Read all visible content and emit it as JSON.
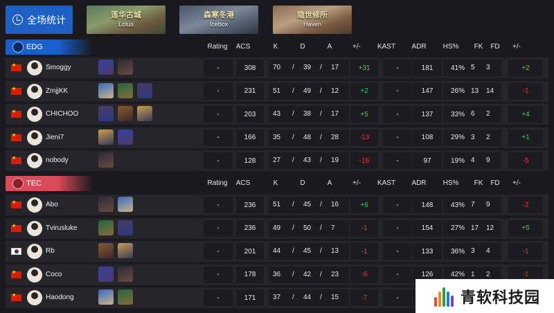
{
  "topbar": {
    "all_stats_label": "全场统计",
    "maps": [
      {
        "zh": "莲华古城",
        "en": "Lotus"
      },
      {
        "zh": "森寒冬港",
        "en": "Icebox"
      },
      {
        "zh": "隐世修所",
        "en": "Haven"
      }
    ]
  },
  "columns": [
    "Rating",
    "ACS",
    "K",
    "D",
    "A",
    "+/-",
    "KAST",
    "ADR",
    "HS%",
    "FK",
    "FD",
    "+/-"
  ],
  "teams": [
    {
      "name": "EDG",
      "players": [
        {
          "flag": "cn",
          "name": "Smoggy",
          "agents": [
            "agent-1",
            "agent-2"
          ],
          "rating": "-",
          "acs": "308",
          "k": "70",
          "d": "39",
          "a": "17",
          "kd_diff": "+31",
          "kast": "-",
          "adr": "181",
          "hs": "41%",
          "fk": "5",
          "fd": "3",
          "fkfd_diff": "+2"
        },
        {
          "flag": "cn",
          "name": "ZmjjKK",
          "agents": [
            "agent-1",
            "agent-2",
            "agent-3"
          ],
          "rating": "-",
          "acs": "231",
          "k": "51",
          "d": "49",
          "a": "12",
          "kd_diff": "+2",
          "kast": "-",
          "adr": "147",
          "hs": "26%",
          "fk": "13",
          "fd": "14",
          "fkfd_diff": "-1"
        },
        {
          "flag": "cn",
          "name": "CHICHOO",
          "agents": [
            "agent-1",
            "agent-2",
            "agent-3"
          ],
          "rating": "-",
          "acs": "203",
          "k": "43",
          "d": "38",
          "a": "17",
          "kd_diff": "+5",
          "kast": "-",
          "adr": "137",
          "hs": "33%",
          "fk": "6",
          "fd": "2",
          "fkfd_diff": "+4"
        },
        {
          "flag": "cn",
          "name": "Jieni7",
          "agents": [
            "agent-1",
            "agent-2"
          ],
          "rating": "-",
          "acs": "166",
          "k": "35",
          "d": "48",
          "a": "28",
          "kd_diff": "-13",
          "kast": "-",
          "adr": "108",
          "hs": "29%",
          "fk": "3",
          "fd": "2",
          "fkfd_diff": "+1"
        },
        {
          "flag": "cn",
          "name": "nobody",
          "agents": [
            "agent-1"
          ],
          "rating": "-",
          "acs": "128",
          "k": "27",
          "d": "43",
          "a": "19",
          "kd_diff": "-16",
          "kast": "-",
          "adr": "97",
          "hs": "19%",
          "fk": "4",
          "fd": "9",
          "fkfd_diff": "-5"
        }
      ]
    },
    {
      "name": "TEC",
      "players": [
        {
          "flag": "cn",
          "name": "Abo",
          "agents": [
            "agent-1",
            "agent-2"
          ],
          "rating": "-",
          "acs": "236",
          "k": "51",
          "d": "45",
          "a": "16",
          "kd_diff": "+6",
          "kast": "-",
          "adr": "148",
          "hs": "43%",
          "fk": "7",
          "fd": "9",
          "fkfd_diff": "-2"
        },
        {
          "flag": "cn",
          "name": "Tvirusluke",
          "agents": [
            "agent-1",
            "agent-2"
          ],
          "rating": "-",
          "acs": "236",
          "k": "49",
          "d": "50",
          "a": "7",
          "kd_diff": "-1",
          "kast": "-",
          "adr": "154",
          "hs": "27%",
          "fk": "17",
          "fd": "12",
          "fkfd_diff": "+5"
        },
        {
          "flag": "kr",
          "name": "Rb",
          "agents": [
            "agent-1",
            "agent-2"
          ],
          "rating": "-",
          "acs": "201",
          "k": "44",
          "d": "45",
          "a": "13",
          "kd_diff": "-1",
          "kast": "-",
          "adr": "133",
          "hs": "36%",
          "fk": "3",
          "fd": "4",
          "fkfd_diff": "-1"
        },
        {
          "flag": "cn",
          "name": "Coco",
          "agents": [
            "agent-1",
            "agent-2"
          ],
          "rating": "-",
          "acs": "178",
          "k": "36",
          "d": "42",
          "a": "23",
          "kd_diff": "-6",
          "kast": "-",
          "adr": "126",
          "hs": "42%",
          "fk": "1",
          "fd": "2",
          "fkfd_diff": "-1"
        },
        {
          "flag": "cn",
          "name": "Haodong",
          "agents": [
            "agent-1",
            "agent-2"
          ],
          "rating": "-",
          "acs": "171",
          "k": "37",
          "d": "44",
          "a": "15",
          "kd_diff": "-7",
          "kast": "-",
          "adr": "130",
          "hs": "",
          "fk": "",
          "fd": "",
          "fkfd_diff": ""
        }
      ]
    }
  ],
  "colors": {
    "positive": "#3ccf5a",
    "negative": "#e83a3a",
    "edg": "#1a5fd0",
    "tec": "#d94a5a"
  },
  "watermark": {
    "text": "青软科技园"
  }
}
